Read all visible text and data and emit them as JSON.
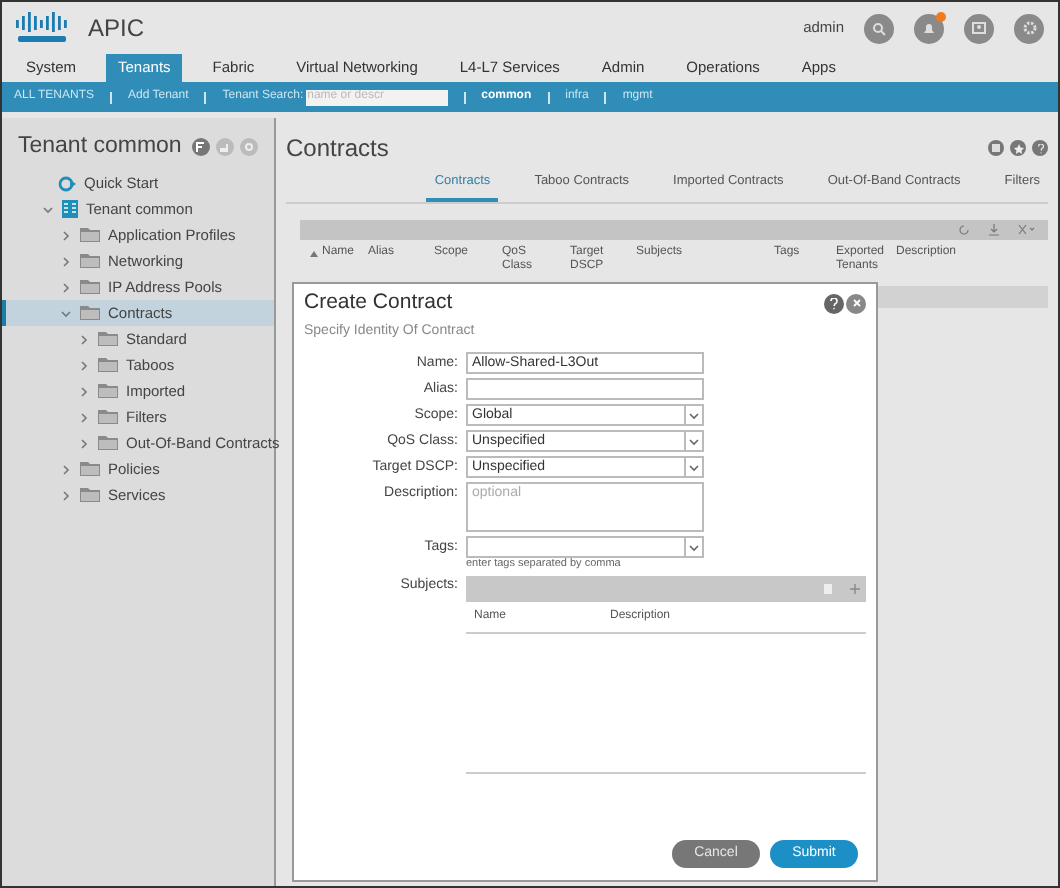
{
  "header": {
    "app_title": "APIC",
    "user": "admin",
    "notifications": true
  },
  "nav_tabs": [
    {
      "label": "System",
      "selected": false
    },
    {
      "label": "Tenants",
      "selected": true
    },
    {
      "label": "Fabric",
      "selected": false
    },
    {
      "label": "Virtual Networking",
      "selected": false
    },
    {
      "label": "L4-L7 Services",
      "selected": false
    },
    {
      "label": "Admin",
      "selected": false
    },
    {
      "label": "Operations",
      "selected": false
    },
    {
      "label": "Apps",
      "selected": false
    }
  ],
  "sub_bar": {
    "all_tenants": "ALL TENANTS",
    "add_tenant": "Add Tenant",
    "search_label": "Tenant Search:",
    "search_placeholder": "name or descr",
    "tenants": [
      {
        "label": "common",
        "selected": true
      },
      {
        "label": "infra",
        "selected": false
      },
      {
        "label": "mgmt",
        "selected": false
      }
    ]
  },
  "sidebar": {
    "title": "Tenant common",
    "items": [
      {
        "label": "Quick Start",
        "kind": "quickstart"
      },
      {
        "label": "Tenant common",
        "kind": "tenant",
        "expanded": true,
        "selected": false,
        "children": [
          {
            "label": "Application Profiles",
            "kind": "folder",
            "expanded": false,
            "selected": false
          },
          {
            "label": "Networking",
            "kind": "folder",
            "expanded": false,
            "selected": false
          },
          {
            "label": "IP Address Pools",
            "kind": "folder",
            "expanded": false,
            "selected": false
          },
          {
            "label": "Contracts",
            "kind": "folder",
            "expanded": true,
            "selected": true,
            "children": [
              {
                "label": "Standard",
                "kind": "folder",
                "expanded": false,
                "selected": false
              },
              {
                "label": "Taboos",
                "kind": "folder",
                "expanded": false,
                "selected": false
              },
              {
                "label": "Imported",
                "kind": "folder",
                "expanded": false,
                "selected": false
              },
              {
                "label": "Filters",
                "kind": "folder",
                "expanded": false,
                "selected": false
              },
              {
                "label": "Out-Of-Band Contracts",
                "kind": "folder",
                "expanded": false,
                "selected": false
              }
            ]
          },
          {
            "label": "Policies",
            "kind": "folder",
            "expanded": false,
            "selected": false
          },
          {
            "label": "Services",
            "kind": "folder",
            "expanded": false,
            "selected": false
          }
        ]
      }
    ]
  },
  "main": {
    "title": "Contracts",
    "tabs": [
      {
        "label": "Contracts",
        "selected": true
      },
      {
        "label": "Taboo Contracts",
        "selected": false
      },
      {
        "label": "Imported Contracts",
        "selected": false
      },
      {
        "label": "Out-Of-Band Contracts",
        "selected": false
      },
      {
        "label": "Filters",
        "selected": false
      }
    ],
    "table": {
      "columns": [
        "Name",
        "Alias",
        "Scope",
        "QoS Class",
        "Target DSCP",
        "Subjects",
        "Tags",
        "Exported Tenants",
        "Description"
      ]
    }
  },
  "dialog": {
    "title": "Create Contract",
    "section": "Specify Identity Of Contract",
    "fields": [
      {
        "label": "Name:",
        "kind": "text",
        "value": "Allow-Shared-L3Out"
      },
      {
        "label": "Alias:",
        "kind": "text"
      },
      {
        "label": "Scope:",
        "kind": "select",
        "value": "Global"
      },
      {
        "label": "QoS Class:",
        "kind": "select",
        "value": "Unspecified"
      },
      {
        "label": "Target DSCP:",
        "kind": "select",
        "value": "Unspecified"
      },
      {
        "label": "Description:",
        "kind": "textarea",
        "placeholder": "optional"
      },
      {
        "label": "Tags:",
        "kind": "select",
        "hint": "enter tags separated by comma"
      }
    ],
    "subjects": {
      "label": "Subjects:",
      "columns": [
        "Name",
        "Description"
      ]
    },
    "buttons": [
      {
        "label": "Cancel",
        "kind": "secondary"
      },
      {
        "label": "Submit",
        "kind": "primary"
      }
    ]
  }
}
